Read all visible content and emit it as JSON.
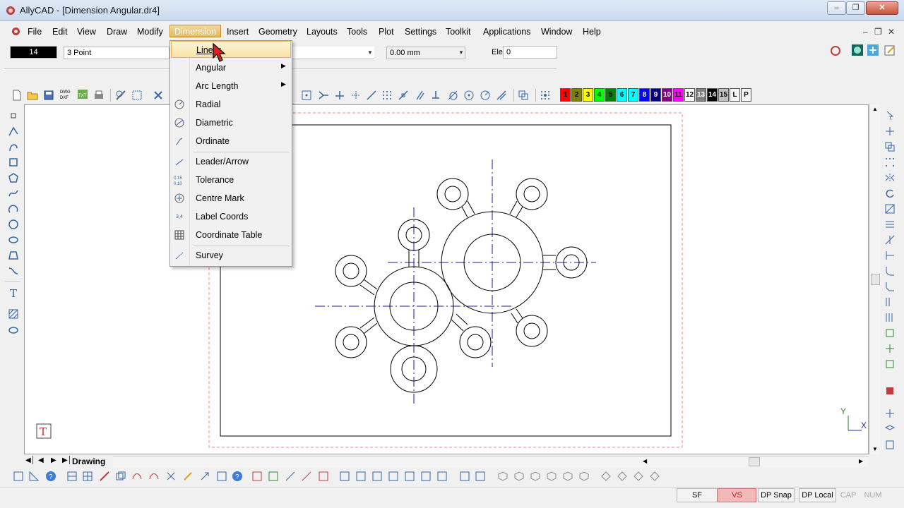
{
  "window": {
    "title": "AllyCAD - [Dimension Angular.dr4]"
  },
  "menubar": {
    "items": [
      "File",
      "Edit",
      "View",
      "Draw",
      "Modify",
      "Dimension",
      "Insert",
      "Geometry",
      "Layouts",
      "Tools",
      "Plot",
      "Settings",
      "Toolkit",
      "Applications",
      "Window",
      "Help"
    ],
    "active": "Dimension"
  },
  "properties": {
    "layer_value": "14",
    "mode_value": "3 Point",
    "thickness_value": "0.00 mm",
    "elev_label": "Elev.",
    "elev_value": "0"
  },
  "colors": {
    "swatches": [
      {
        "label": "1",
        "color": "#ff0000"
      },
      {
        "label": "2",
        "color": "#808000"
      },
      {
        "label": "3",
        "color": "#ffff00"
      },
      {
        "label": "4",
        "color": "#00ff00"
      },
      {
        "label": "5",
        "color": "#008000"
      },
      {
        "label": "6",
        "color": "#00ffff"
      },
      {
        "label": "7",
        "color": "#00ffff"
      },
      {
        "label": "8",
        "color": "#0000ff"
      },
      {
        "label": "9",
        "color": "#000080"
      },
      {
        "label": "10",
        "color": "#800080"
      },
      {
        "label": "11",
        "color": "#ff00ff"
      },
      {
        "label": "12",
        "color": "#ffffff"
      },
      {
        "label": "13",
        "color": "#808080"
      },
      {
        "label": "14",
        "color": "#000000"
      },
      {
        "label": "15",
        "color": "#c0c0c0"
      },
      {
        "label": "L",
        "color": "#f5f5f5"
      },
      {
        "label": "P",
        "color": "#f5f5f5"
      }
    ]
  },
  "dimension_menu": {
    "items": [
      {
        "label": "Linear",
        "icon": "linear-dimension-icon",
        "submenu": false
      },
      {
        "label": "Angular",
        "icon": "angular-dimension-icon",
        "submenu": true
      },
      {
        "label": "Arc Length",
        "icon": "arc-length-icon",
        "submenu": true
      },
      {
        "label": "Radial",
        "icon": "radial-dimension-icon",
        "submenu": false
      },
      {
        "label": "Diametric",
        "icon": "diametric-dimension-icon",
        "submenu": false
      },
      {
        "label": "Ordinate",
        "icon": "ordinate-dimension-icon",
        "submenu": false
      },
      {
        "label": "Leader/Arrow",
        "icon": "leader-arrow-icon",
        "submenu": false
      },
      {
        "label": "Tolerance",
        "icon": "tolerance-icon",
        "submenu": false
      },
      {
        "label": "Centre Mark",
        "icon": "centre-mark-icon",
        "submenu": false
      },
      {
        "label": "Label Coords",
        "icon": "label-coords-icon",
        "submenu": false
      },
      {
        "label": "Coordinate Table",
        "icon": "coordinate-table-icon",
        "submenu": false
      },
      {
        "label": "Survey",
        "icon": "survey-icon",
        "submenu": false
      }
    ],
    "highlighted": "Linear"
  },
  "sheet_tabs": {
    "active": "Drawing"
  },
  "axes": {
    "y": "Y",
    "x": "X"
  },
  "status": {
    "sf": "SF",
    "vs": "VS",
    "dp_snap": "DP Snap",
    "dp_local": "DP Local",
    "cap": "CAP",
    "num": "NUM"
  }
}
